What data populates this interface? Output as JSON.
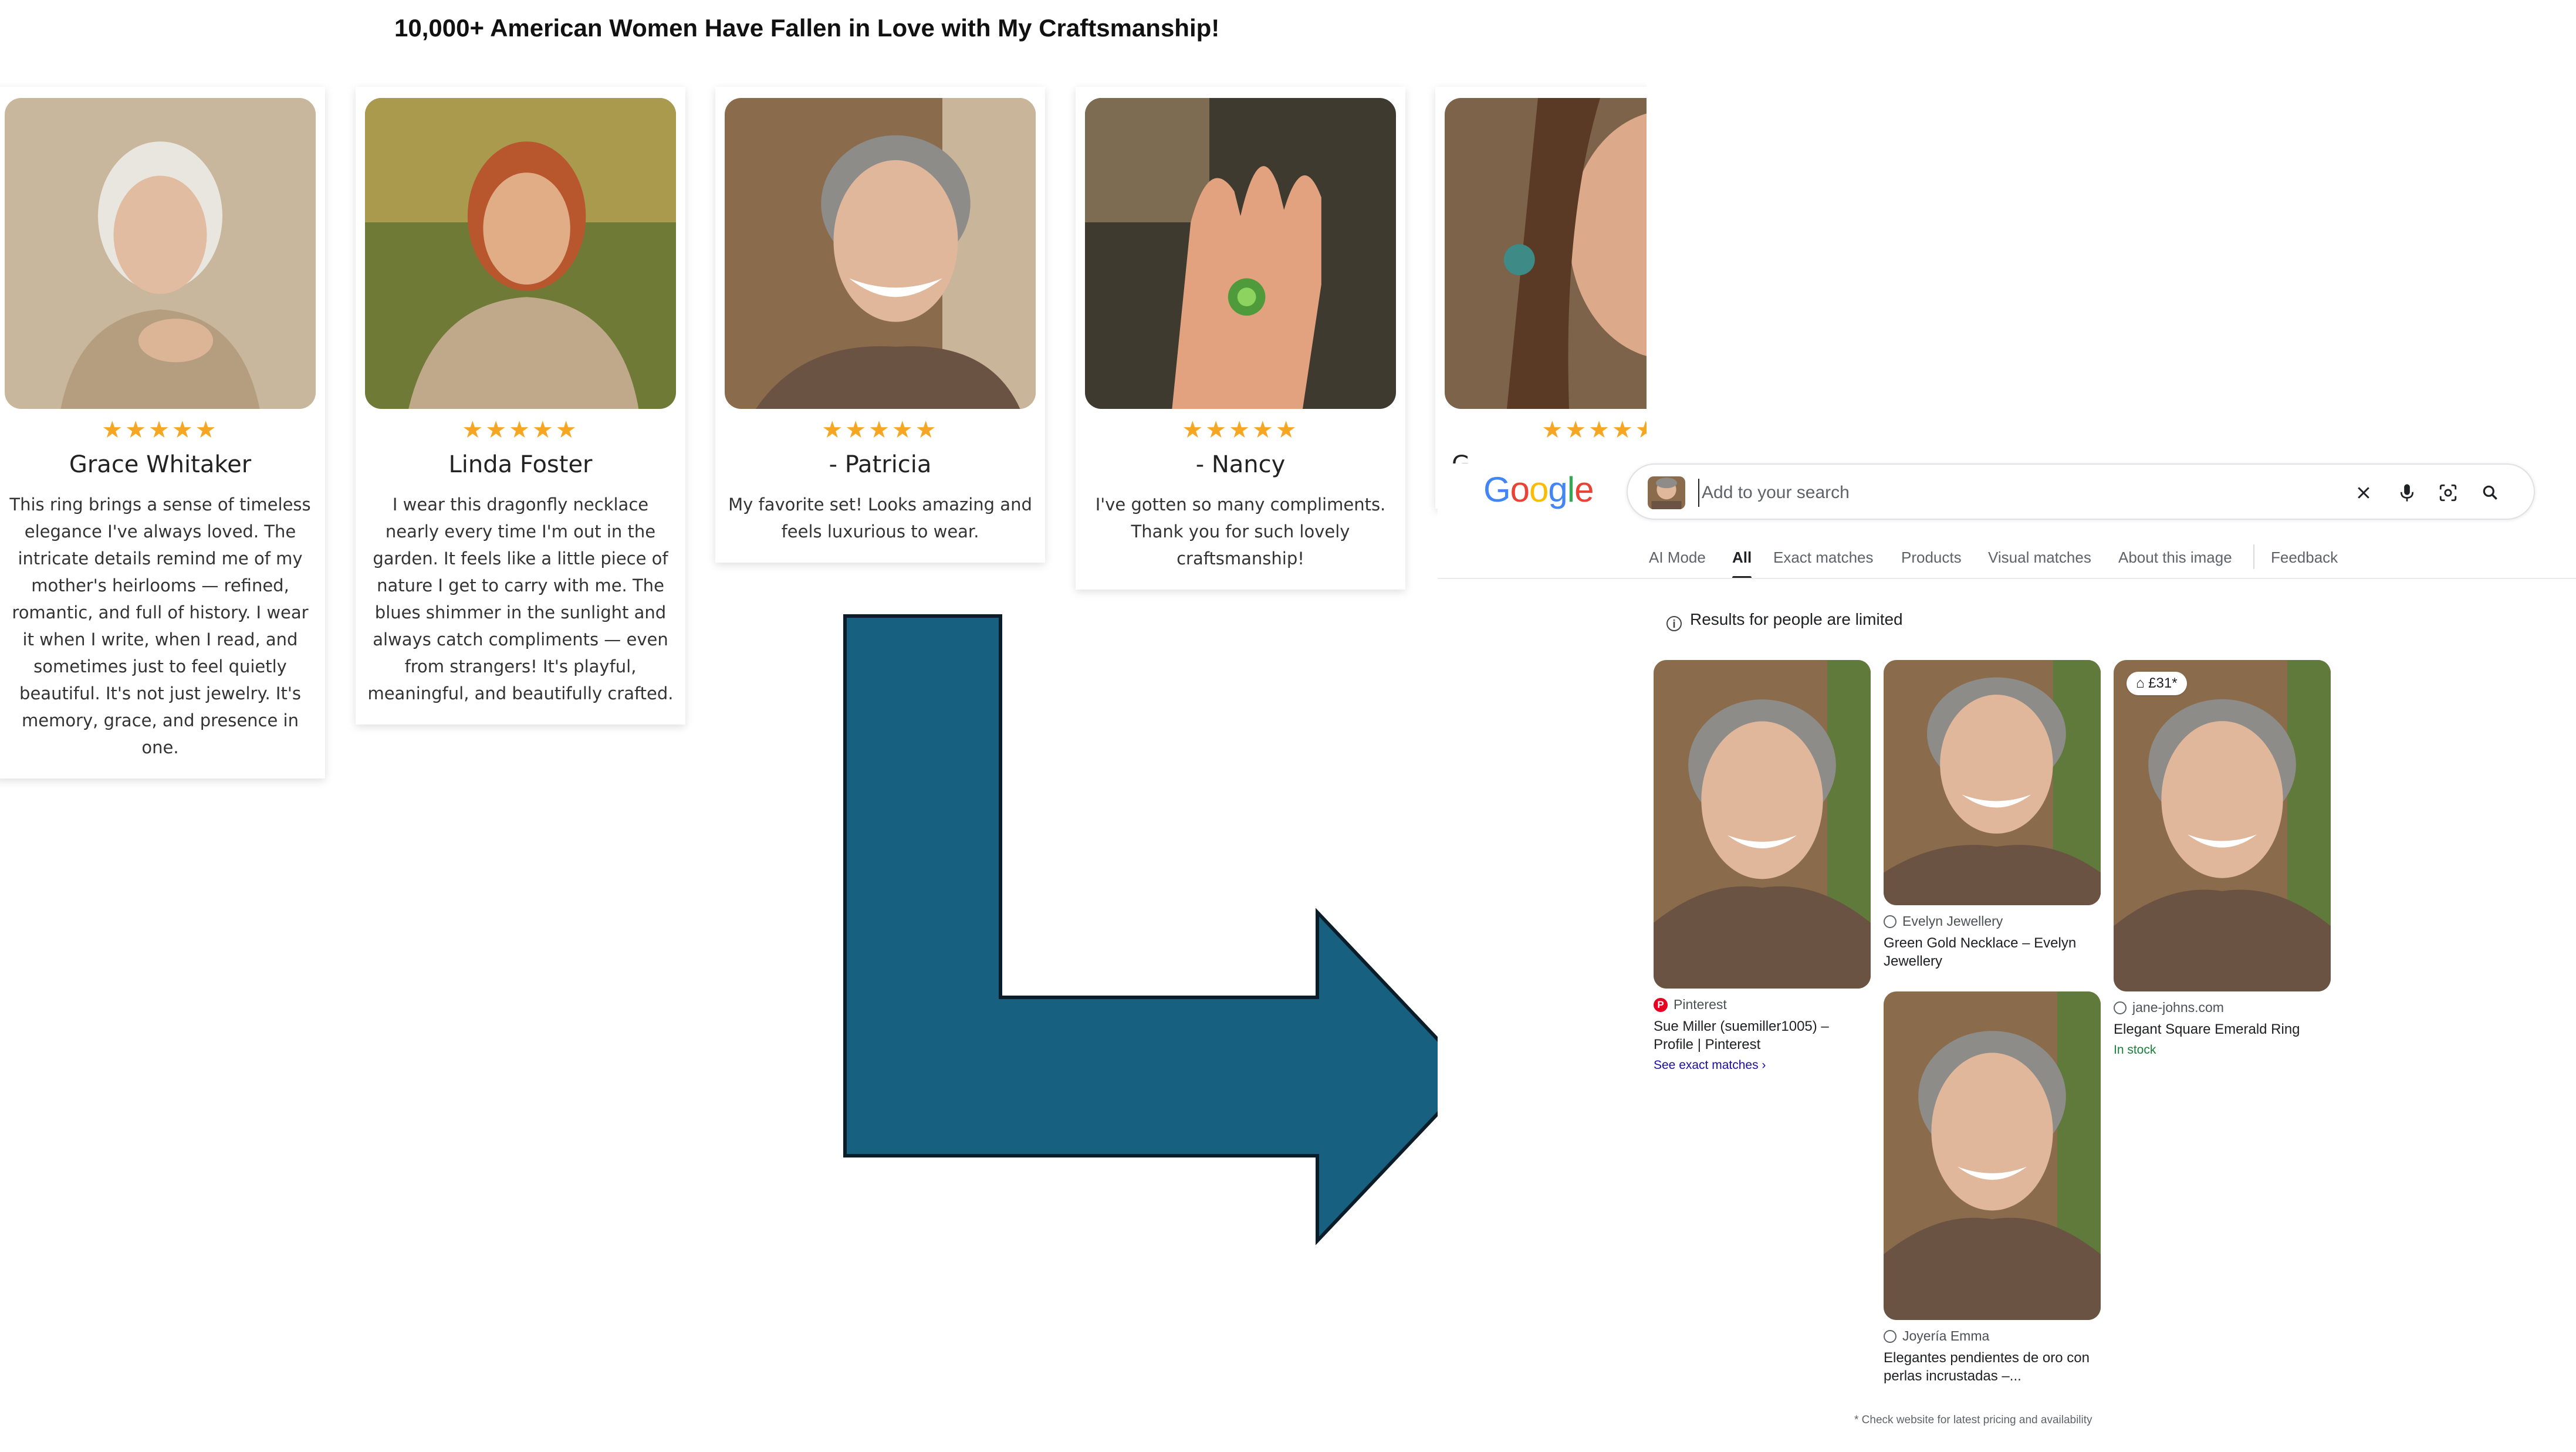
{
  "headline": "10,000+ American Women Have Fallen in Love with My Craftsmanship!",
  "stars": "★★★★★",
  "testimonials": [
    {
      "name": "Grace Whitaker",
      "text": "This ring brings a sense of timeless elegance I've always loved. The intricate details remind me of my mother's heirlooms — refined, romantic, and full of history. I wear it when I write, when I read, and sometimes just to feel quietly beautiful. It's not just jewelry. It's memory, grace, and presence in one."
    },
    {
      "name": "Linda Foster",
      "text": "I wear this dragonfly necklace nearly every time I'm out in the garden. It feels like a little piece of nature I get to carry with me. The blues shimmer in the sunlight and always catch compliments — even from strangers! It's playful, meaningful, and beautifully crafted."
    },
    {
      "name": "- Patricia",
      "text": "My favorite set! Looks amazing and feels luxurious to wear."
    },
    {
      "name": "- Nancy",
      "text": "I've gotten so many compliments. Thank you for such lovely craftsmanship!"
    },
    {
      "name": "G",
      "text": ""
    }
  ],
  "google": {
    "logo": "Google",
    "search_placeholder": "Add to your search",
    "tabs": [
      "AI Mode",
      "All",
      "Exact matches",
      "Products",
      "Visual matches",
      "About this image",
      "Feedback"
    ],
    "active_tab": "All",
    "notice": "Results for people are limited",
    "results": [
      {
        "source": "Pinterest",
        "title": "Sue Miller (suemiller1005) – Profile | Pinterest",
        "extra": "See exact matches"
      },
      {
        "source": "Evelyn Jewellery",
        "title": "Green Gold Necklace – Evelyn Jewellery"
      },
      {
        "source": "jane-johns.com",
        "title": "Elegant Square Emerald Ring",
        "extra": "In stock",
        "price": "£31*"
      },
      {
        "source": "Joyería Emma",
        "title": "Elegantes pendientes de oro con perlas incrustadas –..."
      }
    ],
    "footnote": "* Check website for latest pricing and availability"
  },
  "colors": {
    "arrow": "#17607f",
    "star": "#f5a623",
    "link": "#1a0dab",
    "instock": "#188038"
  }
}
